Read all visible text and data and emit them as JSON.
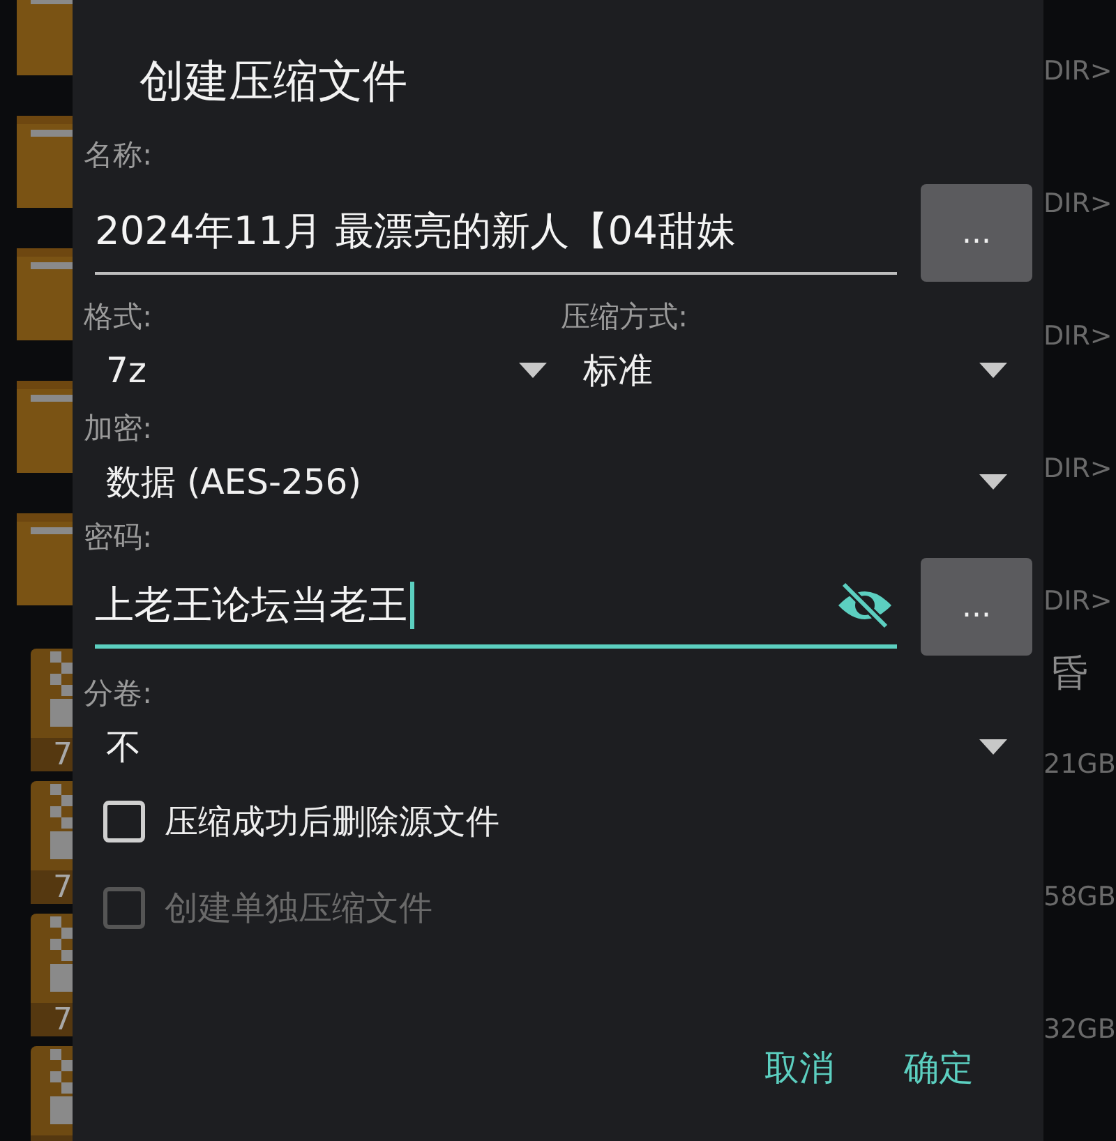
{
  "background_list": {
    "items": [
      {
        "kind": "folder",
        "size": "DIR>"
      },
      {
        "kind": "folder",
        "size": "DIR>"
      },
      {
        "kind": "folder",
        "size": "DIR>"
      },
      {
        "kind": "folder",
        "size": "DIR>"
      },
      {
        "kind": "folder",
        "size": "DIR>"
      },
      {
        "kind": "archive",
        "badge": "7",
        "name": "昏",
        "size": "21GB"
      },
      {
        "kind": "archive",
        "badge": "7",
        "size": "58GB"
      },
      {
        "kind": "archive",
        "badge": "7",
        "size": "32GB"
      },
      {
        "kind": "archive"
      }
    ]
  },
  "dialog": {
    "title": "创建压缩文件",
    "name": {
      "label": "名称:",
      "value": "2024年11月 最漂亮的新人【04甜妹",
      "browse": "..."
    },
    "format": {
      "label": "格式:",
      "value": "7z"
    },
    "method": {
      "label": "压缩方式:",
      "value": "标准"
    },
    "encryption": {
      "label": "加密:",
      "value": "数据 (AES-256)"
    },
    "password": {
      "label": "密码:",
      "value": "上老王论坛当老王",
      "focused": true,
      "revealed": true,
      "browse": "..."
    },
    "split": {
      "label": "分卷:",
      "value": "不"
    },
    "options": [
      {
        "label": "压缩成功后删除源文件",
        "checked": false,
        "disabled": false
      },
      {
        "label": "创建单独压缩文件",
        "checked": false,
        "disabled": true
      }
    ],
    "buttons": [
      "取消",
      "确定"
    ]
  }
}
